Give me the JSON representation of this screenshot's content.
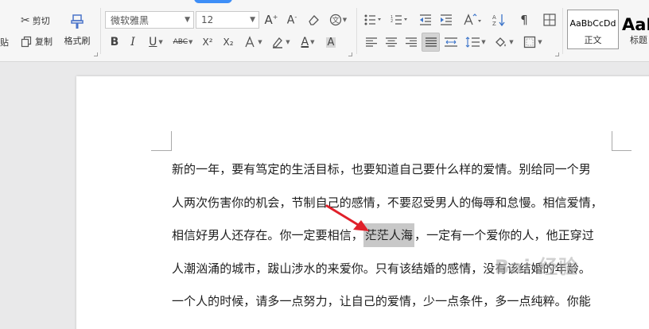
{
  "ribbon": {
    "clipboard": {
      "paste_fragment": "贴",
      "cut": "剪切",
      "copy": "复制",
      "format_painter": "格式刷"
    },
    "font": {
      "family": "微软雅黑",
      "size": "12"
    },
    "styles": {
      "normal_sample": "AaBbCcDd",
      "normal_name": "正文",
      "heading_sample": "AaI",
      "heading_name": "标题"
    },
    "glyphs": {
      "bold": "B",
      "italic": "I",
      "underline": "U",
      "abc": "ABC",
      "superscript": "X²",
      "subscript": "X₂",
      "font_color": "A",
      "shading": "A"
    }
  },
  "document": {
    "lines": [
      "新的一年，要有笃定的生活目标，也要知道自己要什么样的爱情。别给同一个男",
      "人两次伤害你的机会，节制自己的感情，不要忍受男人的侮辱和怠慢。相信爱情，",
      {
        "before": "相信好男人还存在。你一定要相信，",
        "highlight": "茫茫人海",
        "after": "，一定有一个爱你的人，他正穿过"
      },
      "人潮汹涌的城市，跋山涉水的来爱你。只有该结婚的感情，没有该结婚的年龄。",
      "一个人的时候，请多一点努力，让自己的爱情，少一点条件，多一点纯粹。你能"
    ],
    "watermark": "Bai 经验",
    "accent_color": "#e0202a"
  }
}
